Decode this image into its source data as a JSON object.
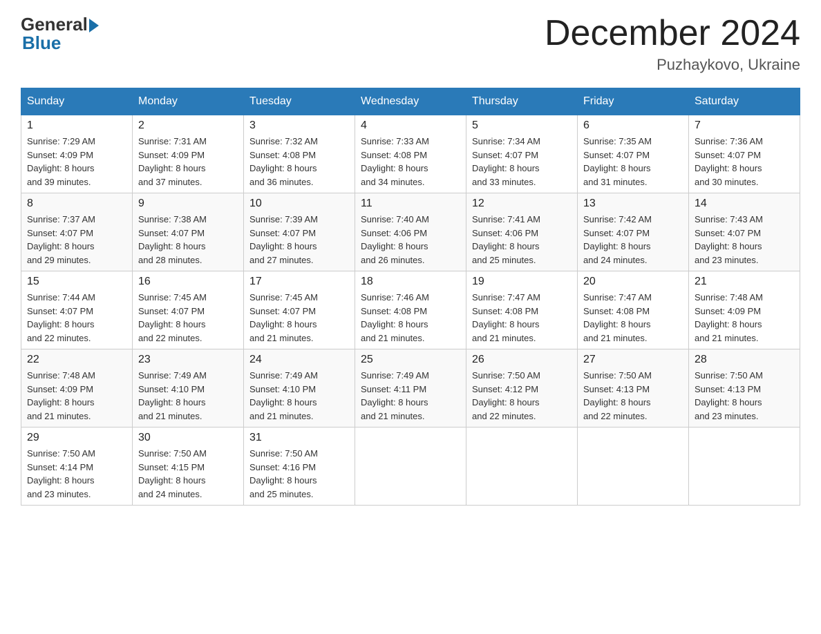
{
  "header": {
    "logo_general": "General",
    "logo_blue": "Blue",
    "title": "December 2024",
    "subtitle": "Puzhaykovo, Ukraine"
  },
  "days_of_week": [
    "Sunday",
    "Monday",
    "Tuesday",
    "Wednesday",
    "Thursday",
    "Friday",
    "Saturday"
  ],
  "weeks": [
    [
      {
        "day": "1",
        "sunrise": "7:29 AM",
        "sunset": "4:09 PM",
        "daylight": "8 hours and 39 minutes."
      },
      {
        "day": "2",
        "sunrise": "7:31 AM",
        "sunset": "4:09 PM",
        "daylight": "8 hours and 37 minutes."
      },
      {
        "day": "3",
        "sunrise": "7:32 AM",
        "sunset": "4:08 PM",
        "daylight": "8 hours and 36 minutes."
      },
      {
        "day": "4",
        "sunrise": "7:33 AM",
        "sunset": "4:08 PM",
        "daylight": "8 hours and 34 minutes."
      },
      {
        "day": "5",
        "sunrise": "7:34 AM",
        "sunset": "4:07 PM",
        "daylight": "8 hours and 33 minutes."
      },
      {
        "day": "6",
        "sunrise": "7:35 AM",
        "sunset": "4:07 PM",
        "daylight": "8 hours and 31 minutes."
      },
      {
        "day": "7",
        "sunrise": "7:36 AM",
        "sunset": "4:07 PM",
        "daylight": "8 hours and 30 minutes."
      }
    ],
    [
      {
        "day": "8",
        "sunrise": "7:37 AM",
        "sunset": "4:07 PM",
        "daylight": "8 hours and 29 minutes."
      },
      {
        "day": "9",
        "sunrise": "7:38 AM",
        "sunset": "4:07 PM",
        "daylight": "8 hours and 28 minutes."
      },
      {
        "day": "10",
        "sunrise": "7:39 AM",
        "sunset": "4:07 PM",
        "daylight": "8 hours and 27 minutes."
      },
      {
        "day": "11",
        "sunrise": "7:40 AM",
        "sunset": "4:06 PM",
        "daylight": "8 hours and 26 minutes."
      },
      {
        "day": "12",
        "sunrise": "7:41 AM",
        "sunset": "4:06 PM",
        "daylight": "8 hours and 25 minutes."
      },
      {
        "day": "13",
        "sunrise": "7:42 AM",
        "sunset": "4:07 PM",
        "daylight": "8 hours and 24 minutes."
      },
      {
        "day": "14",
        "sunrise": "7:43 AM",
        "sunset": "4:07 PM",
        "daylight": "8 hours and 23 minutes."
      }
    ],
    [
      {
        "day": "15",
        "sunrise": "7:44 AM",
        "sunset": "4:07 PM",
        "daylight": "8 hours and 22 minutes."
      },
      {
        "day": "16",
        "sunrise": "7:45 AM",
        "sunset": "4:07 PM",
        "daylight": "8 hours and 22 minutes."
      },
      {
        "day": "17",
        "sunrise": "7:45 AM",
        "sunset": "4:07 PM",
        "daylight": "8 hours and 21 minutes."
      },
      {
        "day": "18",
        "sunrise": "7:46 AM",
        "sunset": "4:08 PM",
        "daylight": "8 hours and 21 minutes."
      },
      {
        "day": "19",
        "sunrise": "7:47 AM",
        "sunset": "4:08 PM",
        "daylight": "8 hours and 21 minutes."
      },
      {
        "day": "20",
        "sunrise": "7:47 AM",
        "sunset": "4:08 PM",
        "daylight": "8 hours and 21 minutes."
      },
      {
        "day": "21",
        "sunrise": "7:48 AM",
        "sunset": "4:09 PM",
        "daylight": "8 hours and 21 minutes."
      }
    ],
    [
      {
        "day": "22",
        "sunrise": "7:48 AM",
        "sunset": "4:09 PM",
        "daylight": "8 hours and 21 minutes."
      },
      {
        "day": "23",
        "sunrise": "7:49 AM",
        "sunset": "4:10 PM",
        "daylight": "8 hours and 21 minutes."
      },
      {
        "day": "24",
        "sunrise": "7:49 AM",
        "sunset": "4:10 PM",
        "daylight": "8 hours and 21 minutes."
      },
      {
        "day": "25",
        "sunrise": "7:49 AM",
        "sunset": "4:11 PM",
        "daylight": "8 hours and 21 minutes."
      },
      {
        "day": "26",
        "sunrise": "7:50 AM",
        "sunset": "4:12 PM",
        "daylight": "8 hours and 22 minutes."
      },
      {
        "day": "27",
        "sunrise": "7:50 AM",
        "sunset": "4:13 PM",
        "daylight": "8 hours and 22 minutes."
      },
      {
        "day": "28",
        "sunrise": "7:50 AM",
        "sunset": "4:13 PM",
        "daylight": "8 hours and 23 minutes."
      }
    ],
    [
      {
        "day": "29",
        "sunrise": "7:50 AM",
        "sunset": "4:14 PM",
        "daylight": "8 hours and 23 minutes."
      },
      {
        "day": "30",
        "sunrise": "7:50 AM",
        "sunset": "4:15 PM",
        "daylight": "8 hours and 24 minutes."
      },
      {
        "day": "31",
        "sunrise": "7:50 AM",
        "sunset": "4:16 PM",
        "daylight": "8 hours and 25 minutes."
      },
      null,
      null,
      null,
      null
    ]
  ],
  "labels": {
    "sunrise": "Sunrise:",
    "sunset": "Sunset:",
    "daylight": "Daylight:"
  }
}
